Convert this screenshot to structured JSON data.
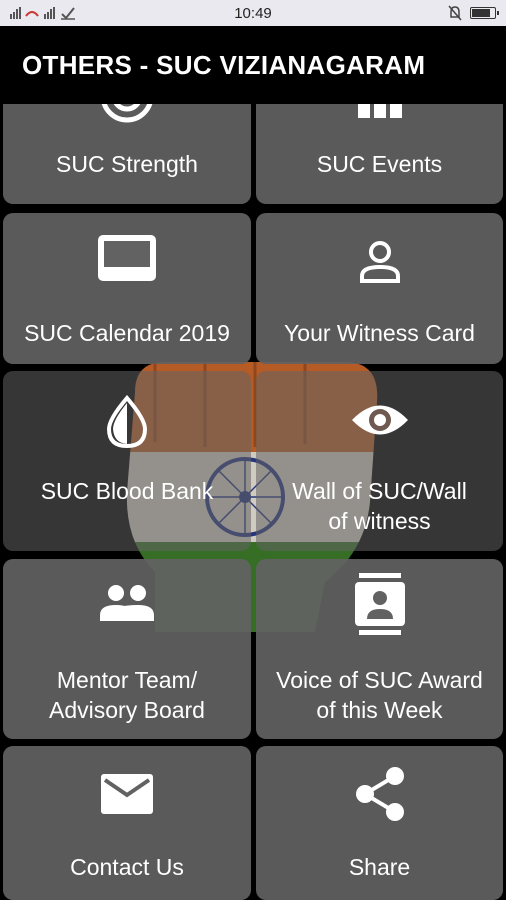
{
  "status_bar": {
    "time": "10:49",
    "battery_level": 0.85
  },
  "app_bar": {
    "title": "OTHERS - SUC VIZIANAGARAM"
  },
  "tiles": [
    {
      "label": "SUC Strength",
      "icon": "target-icon"
    },
    {
      "label": "SUC Events",
      "icon": "columns-icon"
    },
    {
      "label": "SUC Calendar 2019",
      "icon": "calendar-icon"
    },
    {
      "label": "Your Witness Card",
      "icon": "person-icon"
    },
    {
      "label": "SUC Blood Bank",
      "icon": "drop-icon"
    },
    {
      "label": "Wall of SUC/Wall of witness",
      "icon": "eye-icon"
    },
    {
      "label": "Mentor Team/ Advisory Board",
      "icon": "people-icon"
    },
    {
      "label": "Voice of SUC Award of this Week",
      "icon": "contact-card-icon"
    },
    {
      "label": "Contact Us",
      "icon": "mail-icon"
    },
    {
      "label": "Share",
      "icon": "share-icon"
    }
  ]
}
